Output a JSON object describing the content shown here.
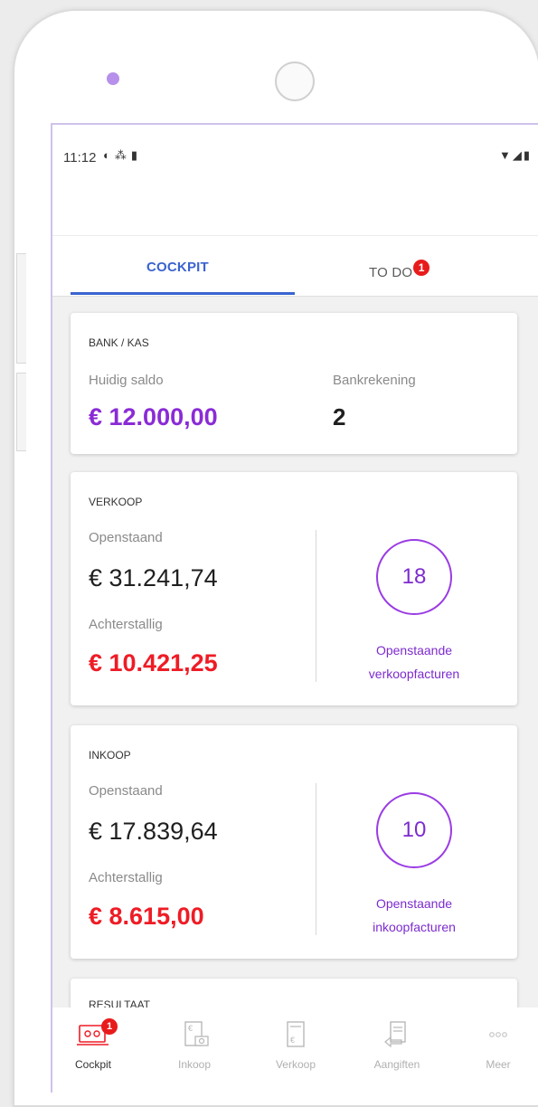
{
  "status_bar": {
    "time": "11:12"
  },
  "tabs": [
    {
      "label": "COCKPIT",
      "active": true
    },
    {
      "label": "TO DO",
      "badge": "1"
    }
  ],
  "cards": {
    "bank": {
      "title": "BANK / KAS",
      "balance_label": "Huidig saldo",
      "balance_value": "€ 12.000,00",
      "accounts_label": "Bankrekening",
      "accounts_value": "2"
    },
    "verkoop": {
      "title": "VERKOOP",
      "open_label": "Openstaand",
      "open_value": "€ 31.241,74",
      "overdue_label": "Achterstallig",
      "overdue_value": "€ 10.421,25",
      "count": "18",
      "count_label_1": "Openstaande",
      "count_label_2": "verkoopfacturen"
    },
    "inkoop": {
      "title": "INKOOP",
      "open_label": "Openstaand",
      "open_value": "€ 17.839,64",
      "overdue_label": "Achterstallig",
      "overdue_value": "€ 8.615,00",
      "count": "10",
      "count_label_1": "Openstaande",
      "count_label_2": "inkoopfacturen"
    },
    "resultaat": {
      "title": "RESULTAAT"
    }
  },
  "bottom_nav": [
    {
      "label": "Cockpit",
      "icon": "cockpit-icon",
      "active": true,
      "badge": "1"
    },
    {
      "label": "Inkoop",
      "icon": "purchase-invoice-icon"
    },
    {
      "label": "Verkoop",
      "icon": "sales-invoice-icon"
    },
    {
      "label": "Aangiften",
      "icon": "tax-return-icon"
    },
    {
      "label": "Meer",
      "icon": "more-dots-icon"
    }
  ],
  "colors": {
    "accent_blue": "#3a63cf",
    "accent_purple": "#8a2bd6",
    "alert_red": "#ee1c25",
    "badge_red": "#e81b1b"
  }
}
